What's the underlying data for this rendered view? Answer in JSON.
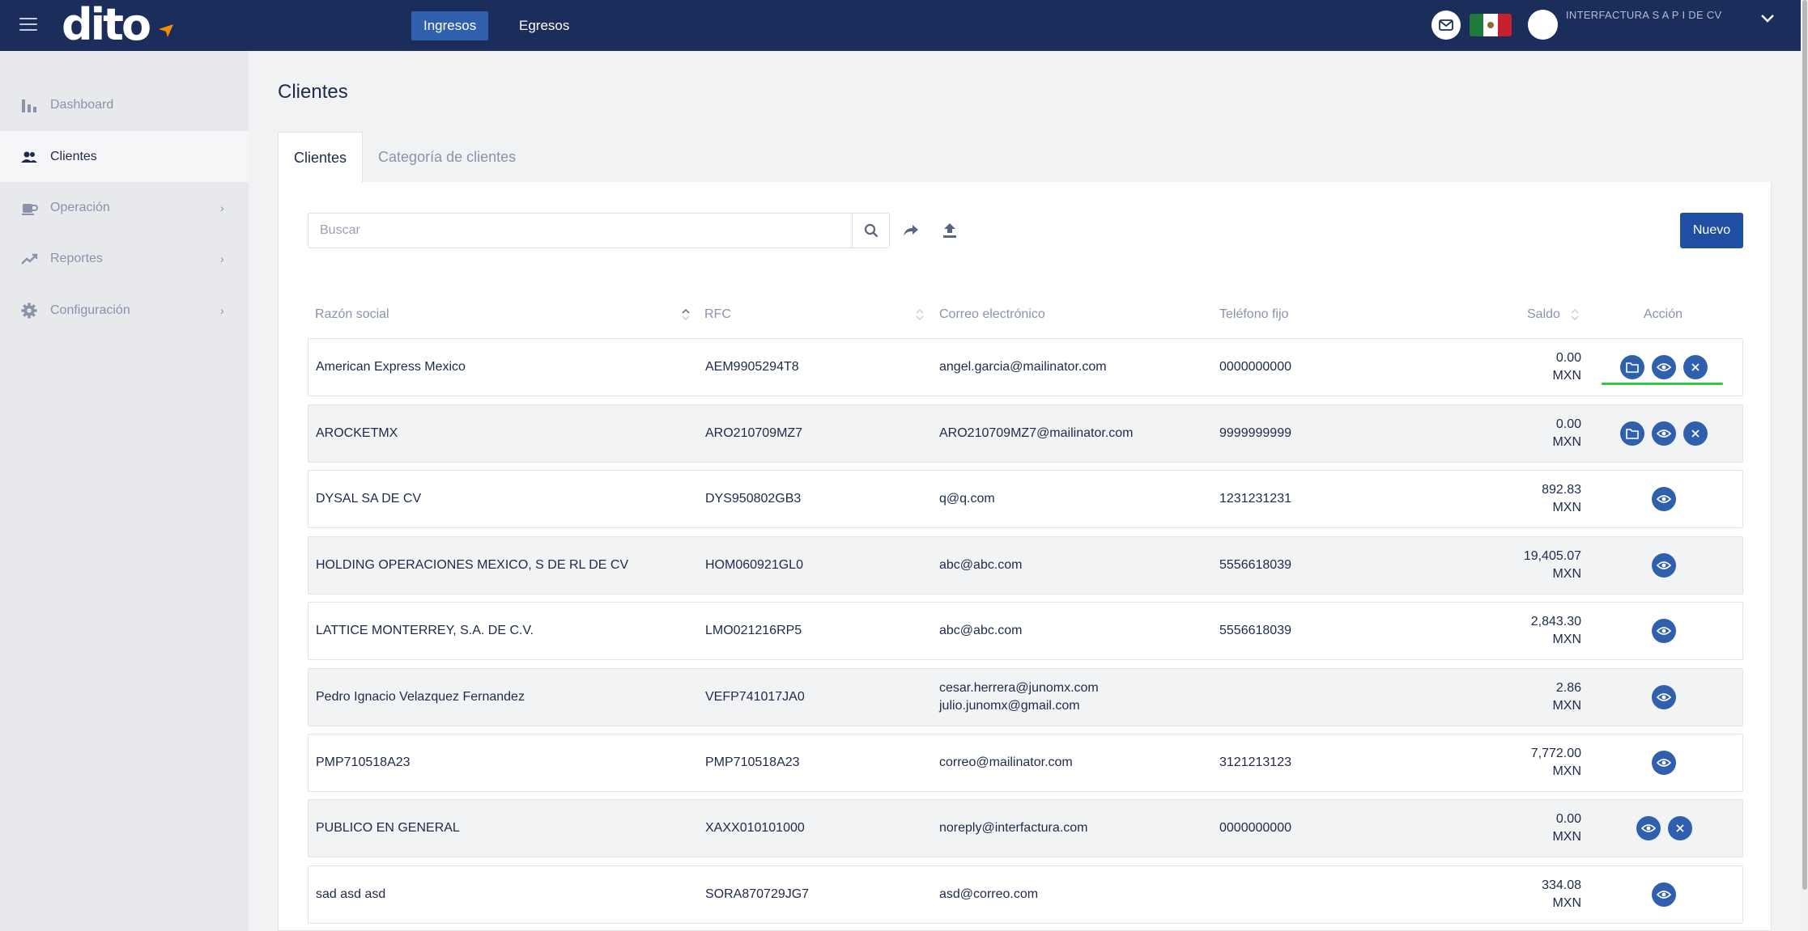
{
  "app": {
    "logo": "dito",
    "colors": {
      "navbar": "#1b2d5b",
      "accent": "#1f4ea3",
      "action_icon": "#2f5fad"
    }
  },
  "topnav": {
    "tabs": [
      {
        "label": "Ingresos",
        "active": true
      },
      {
        "label": "Egresos",
        "active": false
      }
    ]
  },
  "user": {
    "company": "INTERFACTURA S A P I DE CV"
  },
  "sidebar": {
    "items": [
      {
        "label": "Dashboard",
        "icon": "bar-chart-icon"
      },
      {
        "label": "Clientes",
        "icon": "users-icon",
        "active": true
      },
      {
        "label": "Operación",
        "icon": "coffee-cup-icon",
        "expandable": true
      },
      {
        "label": "Reportes",
        "icon": "trending-up-icon",
        "expandable": true
      },
      {
        "label": "Configuración",
        "icon": "gear-icon",
        "expandable": true
      }
    ]
  },
  "page": {
    "title": "Clientes"
  },
  "tabs": [
    {
      "label": "Clientes",
      "active": true
    },
    {
      "label": "Categoría de clientes",
      "active": false
    }
  ],
  "toolbar": {
    "search_placeholder": "Buscar",
    "new_label": "Nuevo"
  },
  "table": {
    "headers": {
      "razon": "Razón social",
      "rfc": "RFC",
      "correo": "Correo electrónico",
      "telefono": "Teléfono fijo",
      "saldo": "Saldo",
      "accion": "Acción"
    },
    "rows": [
      {
        "razon": "American Express Mexico",
        "rfc": "AEM9905294T8",
        "correo": "angel.garcia@mailinator.com",
        "correo2": "",
        "telefono": "0000000000",
        "saldo": "0.00",
        "moneda": "MXN",
        "actions": [
          "folder-icon",
          "eye-icon",
          "close-icon"
        ]
      },
      {
        "razon": "AROCKETMX",
        "rfc": "ARO210709MZ7",
        "correo": "ARO210709MZ7@mailinator.com",
        "correo2": "",
        "telefono": "9999999999",
        "saldo": "0.00",
        "moneda": "MXN",
        "actions": [
          "folder-icon",
          "eye-icon",
          "close-icon"
        ]
      },
      {
        "razon": "DYSAL SA DE CV",
        "rfc": "DYS950802GB3",
        "correo": "q@q.com",
        "correo2": "",
        "telefono": "1231231231",
        "saldo": "892.83",
        "moneda": "MXN",
        "actions": [
          "eye-icon"
        ]
      },
      {
        "razon": "HOLDING OPERACIONES MEXICO, S DE RL DE CV",
        "rfc": "HOM060921GL0",
        "correo": "abc@abc.com",
        "correo2": "",
        "telefono": "5556618039",
        "saldo": "19,405.07",
        "moneda": "MXN",
        "actions": [
          "eye-icon"
        ]
      },
      {
        "razon": "LATTICE MONTERREY, S.A. DE C.V.",
        "rfc": "LMO021216RP5",
        "correo": "abc@abc.com",
        "correo2": "",
        "telefono": "5556618039",
        "saldo": "2,843.30",
        "moneda": "MXN",
        "actions": [
          "eye-icon"
        ]
      },
      {
        "razon": "Pedro Ignacio Velazquez Fernandez",
        "rfc": "VEFP741017JA0",
        "correo": "cesar.herrera@junomx.com",
        "correo2": "julio.junomx@gmail.com",
        "telefono": "",
        "saldo": "2.86",
        "moneda": "MXN",
        "actions": [
          "eye-icon"
        ]
      },
      {
        "razon": "PMP710518A23",
        "rfc": "PMP710518A23",
        "correo": "correo@mailinator.com",
        "correo2": "",
        "telefono": "3121213123",
        "saldo": "7,772.00",
        "moneda": "MXN",
        "actions": [
          "eye-icon"
        ]
      },
      {
        "razon": "PUBLICO EN GENERAL",
        "rfc": "XAXX010101000",
        "correo": "noreply@interfactura.com",
        "correo2": "",
        "telefono": "0000000000",
        "saldo": "0.00",
        "moneda": "MXN",
        "actions": [
          "eye-icon",
          "close-icon"
        ]
      },
      {
        "razon": "sad asd asd",
        "rfc": "SORA870729JG7",
        "correo": "asd@correo.com",
        "correo2": "",
        "telefono": "",
        "saldo": "334.08",
        "moneda": "MXN",
        "actions": [
          "eye-icon"
        ]
      }
    ]
  }
}
